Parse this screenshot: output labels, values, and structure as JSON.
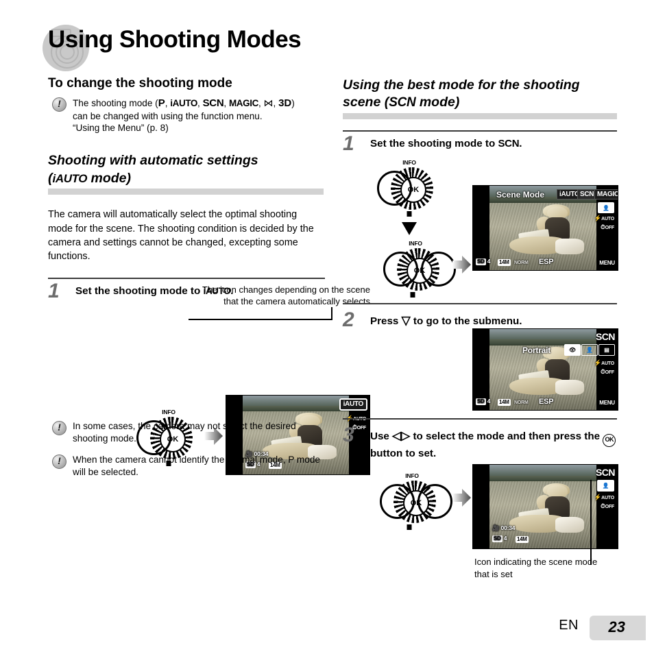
{
  "document": {
    "title": "Using Shooting Modes",
    "footer": {
      "language": "EN",
      "page_number": "23"
    }
  },
  "left_column": {
    "section1": {
      "heading": "To change the shooting mode",
      "note": {
        "line1_prefix": "The shooting mode (",
        "modes": [
          "P",
          "iAUTO",
          "SCN",
          "MAGIC",
          "⋈",
          "3D"
        ],
        "line1_suffix": ")",
        "line2": "can be changed with using the function menu.",
        "line3": "“Using the Menu” (p. 8)"
      }
    },
    "section2": {
      "heading_line1": "Shooting with automatic settings",
      "heading_line2_pre": "(",
      "heading_mode": "iAUTO",
      "heading_line2_post": " mode)",
      "body": "The camera will automatically select the optimal shooting mode for the scene. The shooting condition is decided by the camera and settings cannot be changed, excepting some functions.",
      "step1": {
        "number": "1",
        "text_pre": "Set the shooting mode to ",
        "text_mode": "iAUTO",
        "text_post": "."
      },
      "callout": {
        "line1": "The icon changes depending on the scene",
        "line2": "that the camera automatically selects"
      },
      "lcd": {
        "mode_badge": "iAUTO",
        "flash": "AUTO",
        "timer": "OFF",
        "movie_time": "00:34",
        "shots": "4",
        "image_size": "14M",
        "card_icon": "card-icon"
      },
      "dial": {
        "info_label": "INFO",
        "ok_label": "OK"
      },
      "notes": [
        "In some cases, the camera may not select the desired shooting mode.",
        "When the camera cannot identify the optimal mode, P mode will be selected."
      ],
      "note2_mode": "P"
    }
  },
  "right_column": {
    "heading_line1": "Using the best mode for the shooting",
    "heading_line2_pre": "scene (",
    "heading_mode": "SCN",
    "heading_line2_post": " mode)",
    "step1": {
      "number": "1",
      "text_pre": "Set the shooting mode to ",
      "text_mode": "SCN",
      "text_post": ".",
      "dial_top": {
        "info_label": "INFO",
        "ok_label": "OK"
      },
      "dial_bottom": {
        "info_label": "INFO",
        "ok_label": "OK"
      },
      "lcd": {
        "menu_title": "Scene Mode",
        "tabs": [
          "iAUTO",
          "SCN",
          "MAGIC"
        ],
        "selected_tab": "SCN",
        "flash": "AUTO",
        "timer": "OFF",
        "metering": "ESP",
        "shots": "4",
        "image_size": "14M",
        "quality": "NORM",
        "menu_label": "MENU"
      }
    },
    "step2": {
      "number": "2",
      "text_pre": "Press ",
      "text_glyph": "▽",
      "text_post": " to go to the submenu.",
      "lcd": {
        "scene_name": "Portrait",
        "mode_badge": "SCN",
        "flash": "AUTO",
        "timer": "OFF",
        "metering": "ESP",
        "shots": "4",
        "image_size": "14M",
        "quality": "NORM",
        "menu_label": "MENU"
      }
    },
    "step3": {
      "number": "3",
      "text_pre": "Use ",
      "text_glyph": "◁▷",
      "text_mid": " to select the mode and then press the ",
      "text_ok": "OK",
      "text_post": " button to set.",
      "dial": {
        "info_label": "INFO",
        "ok_label": "OK"
      },
      "lcd": {
        "mode_badge": "SCN",
        "flash": "AUTO",
        "timer": "OFF",
        "movie_time": "00:34",
        "shots": "4",
        "image_size": "14M"
      },
      "caption_line1": "Icon indicating the scene mode",
      "caption_line2": "that is set"
    }
  },
  "colors": {
    "gray_rule": "#d2d2d2",
    "step_number": "#6d6d6d",
    "page_box": "#d8d8d8"
  }
}
